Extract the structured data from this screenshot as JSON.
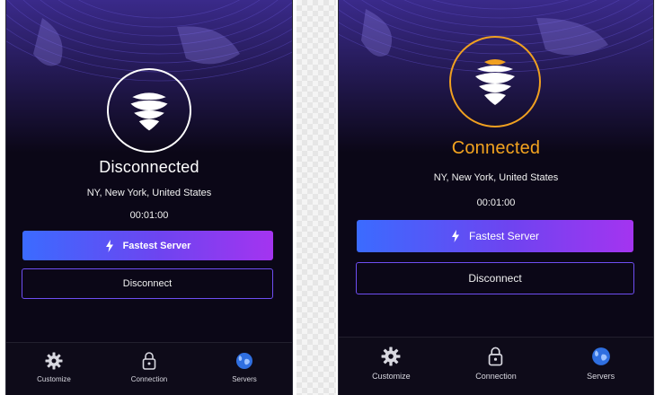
{
  "left_screen": {
    "status": "Disconnected",
    "location": "NY, New York, United States",
    "timer": "00:01:00",
    "fastest_server_label": "Fastest Server",
    "disconnect_label": "Disconnect",
    "tabs": [
      {
        "label": "Customize",
        "icon": "gear-icon"
      },
      {
        "label": "Connection",
        "icon": "lock-icon"
      },
      {
        "label": "Servers",
        "icon": "globe-icon"
      }
    ]
  },
  "right_screen": {
    "status": "Connected",
    "location": "NY, New York, United States",
    "timer": "00:01:00",
    "fastest_server_label": "Fastest Server",
    "disconnect_label": "Disconnect",
    "tabs": [
      {
        "label": "Customize",
        "icon": "gear-icon"
      },
      {
        "label": "Connection",
        "icon": "lock-icon"
      },
      {
        "label": "Servers",
        "icon": "globe-icon"
      }
    ]
  },
  "colors": {
    "background": "#0b0717",
    "connected": "#f3a31f",
    "button_gradient_start": "#3b6bff",
    "button_gradient_end": "#a434f0",
    "outline": "#6e4ef2",
    "servers_icon": "#2f6fe0"
  }
}
